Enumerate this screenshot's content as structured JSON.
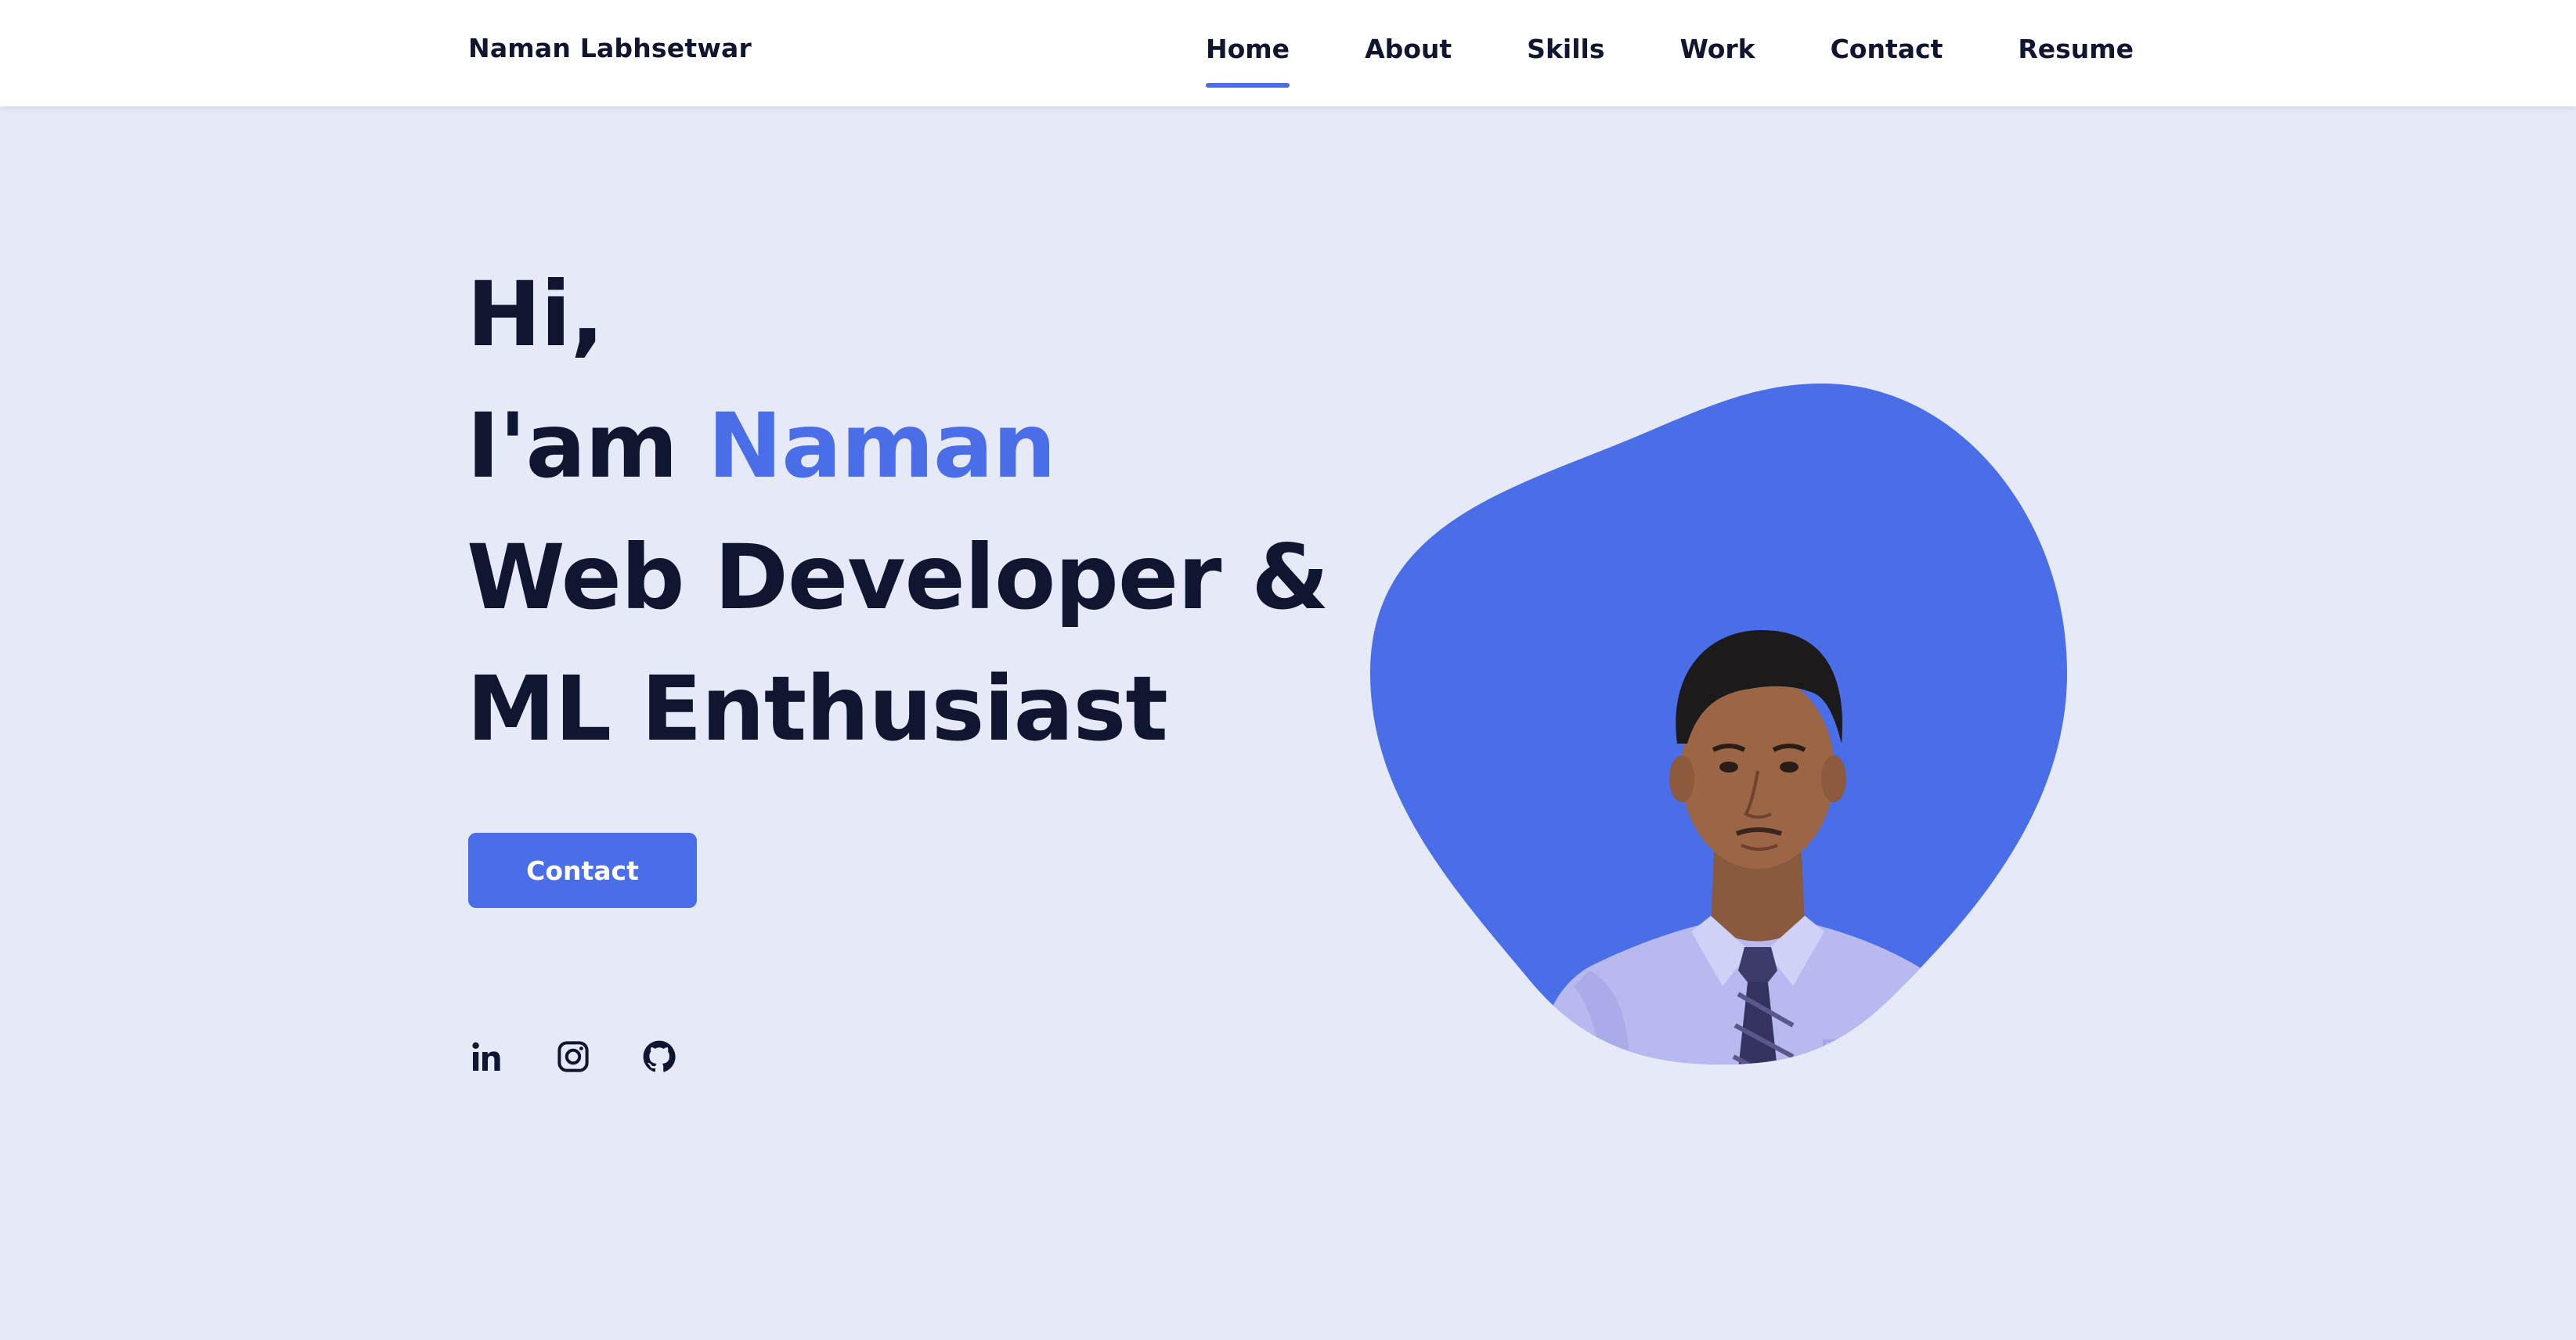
{
  "theme": {
    "accent": "#4a6de8",
    "background": "#e5e9f8",
    "header_bg": "#ffffff",
    "text_dark": "#111630"
  },
  "header": {
    "logo_text": "Naman Labhsetwar",
    "nav": [
      {
        "label": "Home",
        "active": true
      },
      {
        "label": "About",
        "active": false
      },
      {
        "label": "Skills",
        "active": false
      },
      {
        "label": "Work",
        "active": false
      },
      {
        "label": "Contact",
        "active": false
      },
      {
        "label": "Resume",
        "active": false
      }
    ]
  },
  "hero": {
    "greeting": "Hi,",
    "intro_prefix": "I'am ",
    "name": "Naman",
    "role_line1": "Web Developer &",
    "role_line2": "ML Enthusiast",
    "cta_label": "Contact",
    "image_alt": "Portrait of Naman"
  },
  "socials": [
    {
      "icon": "linkedin-icon"
    },
    {
      "icon": "instagram-icon"
    },
    {
      "icon": "github-icon"
    }
  ]
}
